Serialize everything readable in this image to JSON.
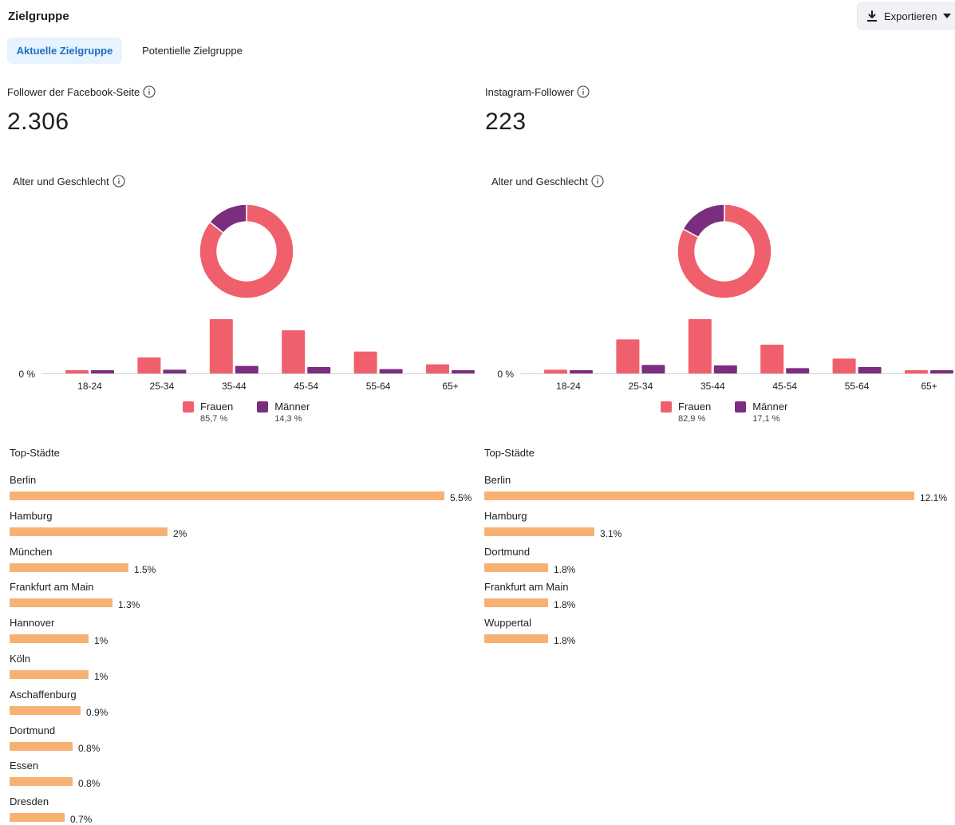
{
  "header": {
    "title": "Zielgruppe",
    "export_label": "Exportieren"
  },
  "tabs": [
    {
      "label": "Aktuelle Zielgruppe",
      "active": true
    },
    {
      "label": "Potentielle Zielgruppe",
      "active": false
    }
  ],
  "colors": {
    "frauen": "#f0606c",
    "maenner": "#7b2d7e",
    "city_bar": "#f7b273",
    "tab_active_bg": "#e7f3ff",
    "tab_active_text": "#1d6fbf"
  },
  "panels": [
    {
      "metric_label": "Follower der Facebook-Seite",
      "metric_value": "2.306",
      "section_label": "Alter und Geschlecht",
      "zero_label": "0 %",
      "legend": [
        {
          "label": "Frauen",
          "pct": "85,7 %"
        },
        {
          "label": "Männer",
          "pct": "14,3 %"
        }
      ],
      "chart_data": {
        "type": "bar",
        "categories": [
          "18-24",
          "25-34",
          "35-44",
          "45-54",
          "55-64",
          "65+"
        ],
        "series": [
          {
            "name": "Frauen",
            "values": [
              0.6,
              3.0,
              10.2,
              8.1,
              4.1,
              1.7
            ]
          },
          {
            "name": "Männer",
            "values": [
              0.6,
              0.7,
              1.4,
              1.2,
              0.8,
              0.6
            ]
          }
        ],
        "ylim": [
          0,
          10.2
        ],
        "donut": [
          {
            "name": "Frauen",
            "value": 85.7
          },
          {
            "name": "Männer",
            "value": 14.3
          }
        ]
      },
      "cities_title": "Top-Städte",
      "cities": [
        {
          "name": "Berlin",
          "value": 5.5,
          "label": "5.5%"
        },
        {
          "name": "Hamburg",
          "value": 2,
          "label": "2%"
        },
        {
          "name": "München",
          "value": 1.5,
          "label": "1.5%"
        },
        {
          "name": "Frankfurt am Main",
          "value": 1.3,
          "label": "1.3%"
        },
        {
          "name": "Hannover",
          "value": 1,
          "label": "1%"
        },
        {
          "name": "Köln",
          "value": 1,
          "label": "1%"
        },
        {
          "name": "Aschaffenburg",
          "value": 0.9,
          "label": "0.9%"
        },
        {
          "name": "Dortmund",
          "value": 0.8,
          "label": "0.8%"
        },
        {
          "name": "Essen",
          "value": 0.8,
          "label": "0.8%"
        },
        {
          "name": "Dresden",
          "value": 0.7,
          "label": "0.7%"
        }
      ]
    },
    {
      "metric_label": "Instagram-Follower",
      "metric_value": "223",
      "section_label": "Alter und Geschlecht",
      "zero_label": "0 %",
      "legend": [
        {
          "label": "Frauen",
          "pct": "82,9 %"
        },
        {
          "label": "Männer",
          "pct": "17,1 %"
        }
      ],
      "chart_data": {
        "type": "bar",
        "categories": [
          "18-24",
          "25-34",
          "35-44",
          "45-54",
          "55-64",
          "65+"
        ],
        "series": [
          {
            "name": "Frauen",
            "values": [
              0.7,
              6.4,
              10.2,
              5.4,
              2.8,
              0.6
            ]
          },
          {
            "name": "Männer",
            "values": [
              0.6,
              1.6,
              1.5,
              1.0,
              1.2,
              0.6
            ]
          }
        ],
        "ylim": [
          0,
          10.2
        ],
        "donut": [
          {
            "name": "Frauen",
            "value": 82.9
          },
          {
            "name": "Männer",
            "value": 17.1
          }
        ]
      },
      "cities_title": "Top-Städte",
      "cities": [
        {
          "name": "Berlin",
          "value": 12.1,
          "label": "12.1%"
        },
        {
          "name": "Hamburg",
          "value": 3.1,
          "label": "3.1%"
        },
        {
          "name": "Dortmund",
          "value": 1.8,
          "label": "1.8%"
        },
        {
          "name": "Frankfurt am Main",
          "value": 1.8,
          "label": "1.8%"
        },
        {
          "name": "Wuppertal",
          "value": 1.8,
          "label": "1.8%"
        }
      ]
    }
  ]
}
